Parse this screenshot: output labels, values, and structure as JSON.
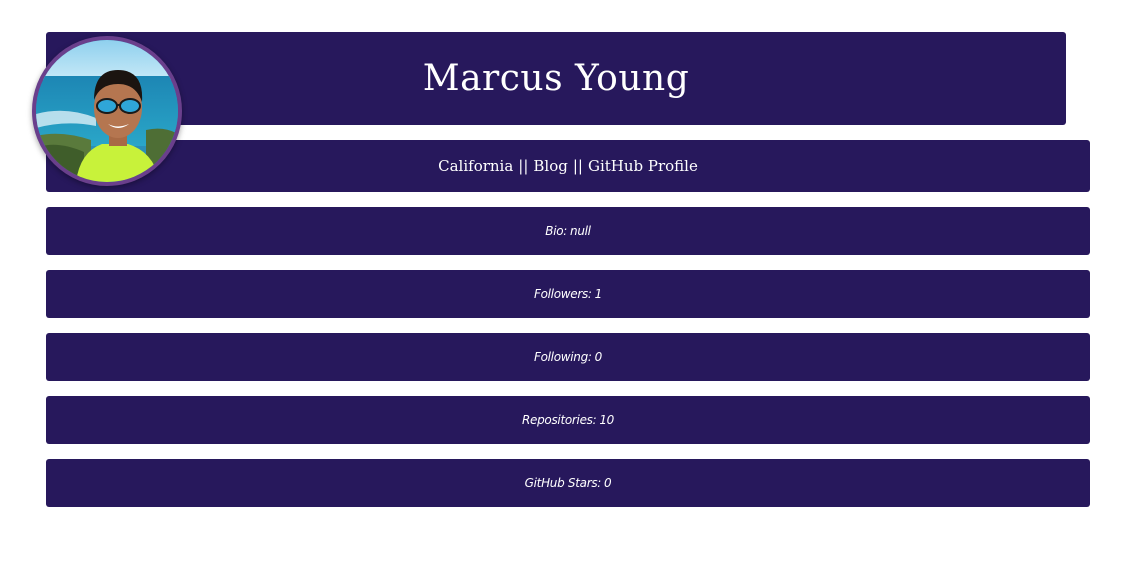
{
  "profile": {
    "name": "Marcus Young",
    "location": "California",
    "separator": "||",
    "blog_label": "Blog",
    "github_label": "GitHub Profile"
  },
  "stats": {
    "bio_label": "Bio:",
    "bio_value": "null",
    "followers_label": "Followers:",
    "followers_value": "1",
    "following_label": "Following:",
    "following_value": "0",
    "repos_label": "Repositories:",
    "repos_value": "10",
    "stars_label": "GitHub Stars:",
    "stars_value": "0"
  },
  "colors": {
    "panel": "#27185c",
    "avatar_border": "#6a3f8c",
    "text": "#ffffff"
  }
}
